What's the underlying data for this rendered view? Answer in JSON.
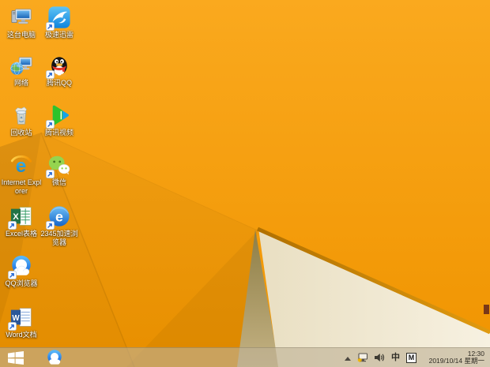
{
  "desktop": {
    "icons": {
      "this_pc": "这台电脑",
      "xunlei": "极速迅雷",
      "network": "网络",
      "qq": "腾讯QQ",
      "recycle_bin": "回收站",
      "tencent_video": "腾讯视频",
      "ie": "Internet Explorer",
      "wechat": "微信",
      "excel": "Excel表格",
      "browser2345": "2345加速浏览器",
      "qq_browser": "QQ浏览器",
      "word": "Word文档"
    }
  },
  "taskbar": {
    "tray": {
      "ime_mode": "中",
      "ime_lang": "M"
    },
    "clock": {
      "time": "12:30",
      "date": "2019/10/14 星期一"
    }
  },
  "colors": {
    "wallpaper_orange": "#F5A00D",
    "wallpaper_orange_dark": "#E68E00",
    "wallpaper_cream": "#F2E9D3",
    "wallpaper_shadow": "#A6955D",
    "fold_edge": "#C07B00",
    "taskbar_tint": "#BEB296"
  }
}
